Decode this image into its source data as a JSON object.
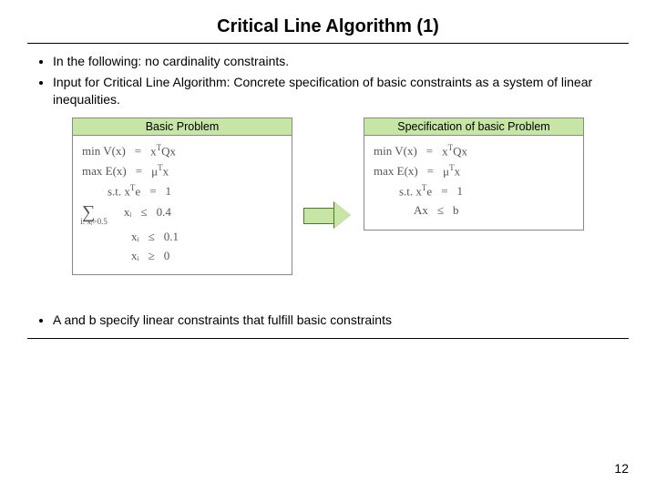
{
  "title": "Critical Line Algorithm (1)",
  "bullets_top": [
    "In the following: no cardinality constraints.",
    "Input for Critical Line Algorithm: Concrete specification of basic constraints as a system of linear inequalities."
  ],
  "left_panel": {
    "header": "Basic Problem",
    "rows": {
      "r1_lhs": "min V(x)",
      "r1_op": "=",
      "r1_rhs_a": "x",
      "r1_rhs_sup": "T",
      "r1_rhs_b": "Qx",
      "r2_lhs": "max E(x)",
      "r2_op": "=",
      "r2_rhs_a": "μ",
      "r2_rhs_sup": "T",
      "r2_rhs_b": "x",
      "r3_lhs_a": "s.t. x",
      "r3_lhs_sup": "T",
      "r3_lhs_b": "e",
      "r3_op": "=",
      "r3_rhs": "1",
      "r4_sum": "∑",
      "r4_sumsub": "i: xᵢ>0.5",
      "r4_body": "xᵢ",
      "r4_op": "≤",
      "r4_rhs": "0.4",
      "r5_lhs": "xᵢ",
      "r5_op": "≤",
      "r5_rhs": "0.1",
      "r6_lhs": "xᵢ",
      "r6_op": "≥",
      "r6_rhs": "0"
    }
  },
  "right_panel": {
    "header": "Specification of basic Problem",
    "rows": {
      "r1_lhs": "min V(x)",
      "r1_op": "=",
      "r1_rhs_a": "x",
      "r1_rhs_sup": "T",
      "r1_rhs_b": "Qx",
      "r2_lhs": "max E(x)",
      "r2_op": "=",
      "r2_rhs_a": "μ",
      "r2_rhs_sup": "T",
      "r2_rhs_b": "x",
      "r3_lhs_a": "s.t. x",
      "r3_lhs_sup": "T",
      "r3_lhs_b": "e",
      "r3_op": "=",
      "r3_rhs": "1",
      "r4_lhs": "Ax",
      "r4_op": "≤",
      "r4_rhs": "b"
    }
  },
  "bullets_bottom": [
    "A and b specify linear constraints that fulfill basic constraints"
  ],
  "page_number": "12"
}
